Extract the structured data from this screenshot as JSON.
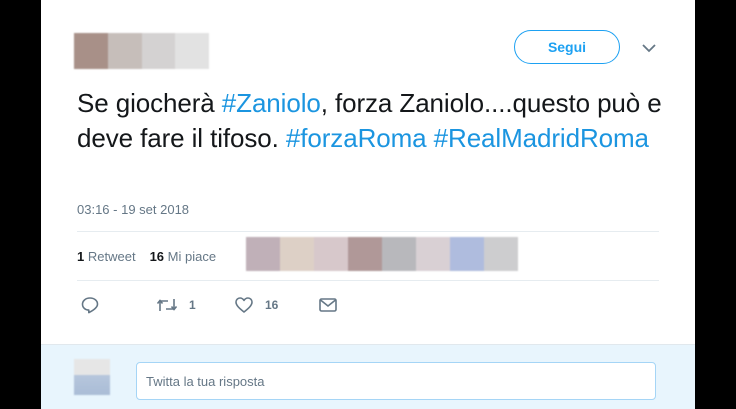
{
  "header": {
    "follow_label": "Segui",
    "avatar_icon": "blurred-avatar",
    "menu_icon": "chevron-down-icon"
  },
  "tweet": {
    "text_parts": [
      {
        "text": "Se giocherà ",
        "hashtag": false
      },
      {
        "text": "#Zaniolo",
        "hashtag": true
      },
      {
        "text": ", forza Zaniolo....questo può e deve fare il tifoso. ",
        "hashtag": false
      },
      {
        "text": "#forzaRoma",
        "hashtag": true
      },
      {
        "text": " ",
        "hashtag": false
      },
      {
        "text": "#RealMadridRoma",
        "hashtag": true
      }
    ],
    "timestamp": "03:16 - 19 set 2018"
  },
  "stats": {
    "retweet_count": "1",
    "retweet_label": "Retweet",
    "like_count": "16",
    "like_label": "Mi piace"
  },
  "actions": {
    "retweet_count": "1",
    "like_count": "16"
  },
  "reply": {
    "placeholder": "Twitta la tua risposta"
  },
  "colors": {
    "accent": "#1da1f2",
    "hashtag": "#1b95e0",
    "text": "#14171a",
    "muted": "#657786",
    "reply_bg": "#e8f5fd"
  }
}
